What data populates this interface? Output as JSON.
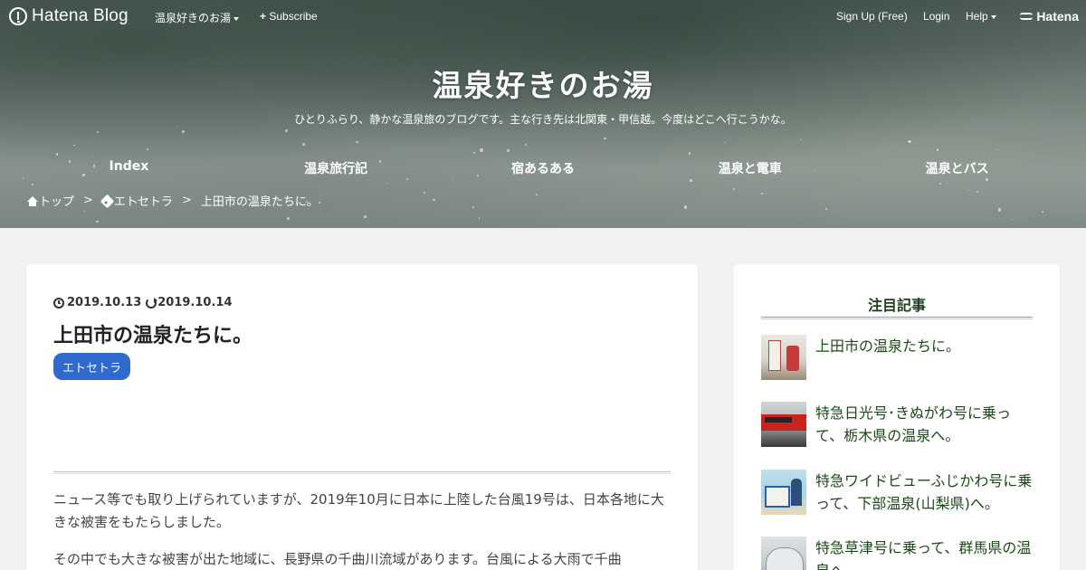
{
  "globalnav": {
    "brand": "Hatena Blog",
    "blog_menu": "温泉好きのお湯",
    "subscribe": "Subscribe",
    "signup": "Sign Up (Free)",
    "login": "Login",
    "help": "Help",
    "hatena": "Hatena"
  },
  "header": {
    "title": "温泉好きのお湯",
    "description": "ひとりふらり、静かな温泉旅のブログです。主な行き先は北関東・甲信越。今度はどこへ行こうかな。"
  },
  "catnav": [
    "Index",
    "温泉旅行記",
    "宿あるある",
    "温泉と電車",
    "温泉とバス"
  ],
  "breadcrumb": {
    "home": "トップ",
    "sep": ">",
    "category": "エトセトラ",
    "current": "上田市の温泉たちに。"
  },
  "article": {
    "published": "2019.10.13",
    "updated": "2019.10.14",
    "title": "上田市の温泉たちに。",
    "category": "エトセトラ",
    "paragraph1": "ニュース等でも取り上げられていますが、2019年10月に日本に上陸した台風19号は、日本各地に大きな被害をもたらしました。",
    "paragraph2": "その中でも大きな被害が出た地域に、長野県の千曲川流域があります。台風による大雨で千曲"
  },
  "sidebar": {
    "title": "注目記事",
    "items": [
      {
        "label": "上田市の温泉たちに。",
        "thumb": "photo"
      },
      {
        "label": "特急日光号･きぬがわ号に乗って、栃木県の温泉へ。",
        "thumb": "photo"
      },
      {
        "label": "特急ワイドビューふじかわ号に乗って、下部温泉(山梨県)へ。",
        "thumb": "photo"
      },
      {
        "label": "特急草津号に乗って、群馬県の温泉へ。",
        "thumb": "photo"
      }
    ]
  },
  "colors": {
    "badge": "#2f6bce",
    "sidebar_link": "#1d4a18",
    "page_bg": "#f2f2f2"
  }
}
